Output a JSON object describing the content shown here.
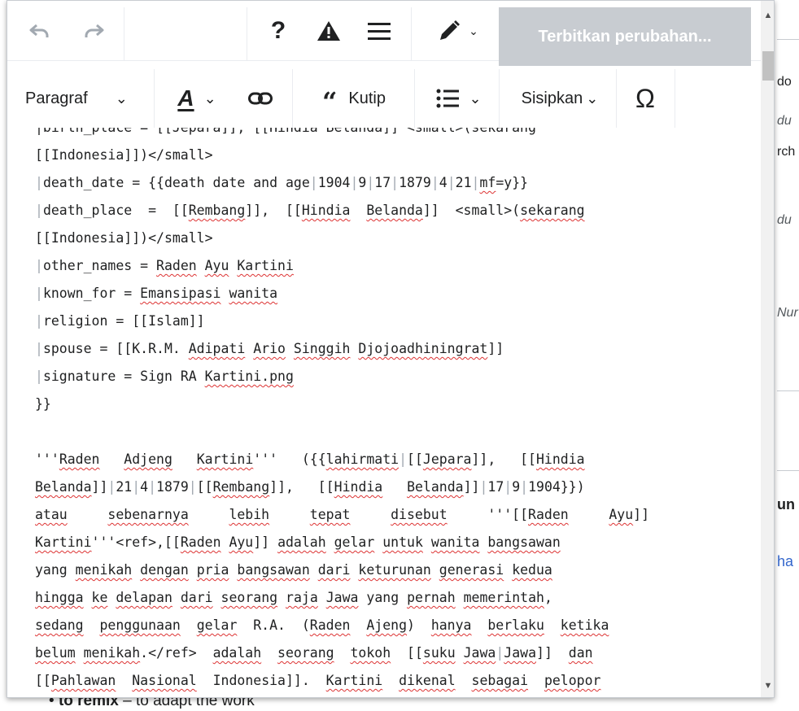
{
  "background": {
    "fragments": [
      "do",
      "du",
      "rch",
      "du",
      "Nur",
      "un",
      "ha"
    ],
    "bottom_bold": "to remix",
    "bottom_rest": " – to adapt the work"
  },
  "toolbar": {
    "undo_icon": "undo-icon",
    "redo_icon": "redo-icon",
    "help_label": "?",
    "notices_label": "▲",
    "page_options_label": "☰",
    "edit_mode_label": "✎",
    "publish_label": "Terbitkan perubahan...",
    "paragraph_label": "Paragraf",
    "style_label": "A",
    "link_icon": "link-icon",
    "quote_label": "Kutip",
    "list_label": "☰",
    "insert_label": "Sisipkan",
    "special_chars_label": "Ω"
  },
  "editor": {
    "lines": [
      [
        {
          "t": "|birth_place = [[Jepara]], [[Hindia Belanda]] <small>(sekarang",
          "s": false
        }
      ],
      [
        {
          "t": "[[Indonesia]])</small>",
          "s": false
        }
      ],
      [
        {
          "t": "|",
          "p": true
        },
        {
          "t": "death_date = {{death date and age",
          "s": false
        },
        {
          "t": "|",
          "p": true
        },
        {
          "t": "1904",
          "s": false
        },
        {
          "t": "|",
          "p": true
        },
        {
          "t": "9",
          "s": false
        },
        {
          "t": "|",
          "p": true
        },
        {
          "t": "17",
          "s": false
        },
        {
          "t": "|",
          "p": true
        },
        {
          "t": "1879",
          "s": false
        },
        {
          "t": "|",
          "p": true
        },
        {
          "t": "4",
          "s": false
        },
        {
          "t": "|",
          "p": true
        },
        {
          "t": "21",
          "s": false
        },
        {
          "t": "|",
          "p": true
        },
        {
          "t": "mf",
          "s": true
        },
        {
          "t": "=y}}",
          "s": false
        }
      ],
      [
        {
          "t": "|",
          "p": true
        },
        {
          "t": "death_place  =  [[",
          "s": false
        },
        {
          "t": "Rembang",
          "s": true
        },
        {
          "t": "]],  [[",
          "s": false
        },
        {
          "t": "Hindia",
          "s": true
        },
        {
          "t": "  ",
          "s": false
        },
        {
          "t": "Belanda",
          "s": true
        },
        {
          "t": "]]  <small>(",
          "s": false
        },
        {
          "t": "sekarang",
          "s": true
        }
      ],
      [
        {
          "t": "[[Indonesia]])</small>",
          "s": false
        }
      ],
      [
        {
          "t": "|",
          "p": true
        },
        {
          "t": "other_names = ",
          "s": false
        },
        {
          "t": "Raden",
          "s": true
        },
        {
          "t": " ",
          "s": false
        },
        {
          "t": "Ayu",
          "s": true
        },
        {
          "t": " ",
          "s": false
        },
        {
          "t": "Kartini",
          "s": true
        }
      ],
      [
        {
          "t": "|",
          "p": true
        },
        {
          "t": "known_for = ",
          "s": false
        },
        {
          "t": "Emansipasi",
          "s": true
        },
        {
          "t": " ",
          "s": false
        },
        {
          "t": "wanita",
          "s": true
        }
      ],
      [
        {
          "t": "|",
          "p": true
        },
        {
          "t": "religion = [[Islam]]",
          "s": false
        }
      ],
      [
        {
          "t": "|",
          "p": true
        },
        {
          "t": "spouse = [[K.R.M. ",
          "s": false
        },
        {
          "t": "Adipati",
          "s": true
        },
        {
          "t": " ",
          "s": false
        },
        {
          "t": "Ario",
          "s": true
        },
        {
          "t": " ",
          "s": false
        },
        {
          "t": "Singgih",
          "s": true
        },
        {
          "t": " ",
          "s": false
        },
        {
          "t": "Djojoadhiningrat",
          "s": true
        },
        {
          "t": "]]",
          "s": false
        }
      ],
      [
        {
          "t": "|",
          "p": true
        },
        {
          "t": "signature = Sign RA ",
          "s": false
        },
        {
          "t": "Kartini.png",
          "s": true
        }
      ],
      [
        {
          "t": "}}",
          "s": false
        }
      ],
      [
        {
          "t": " ",
          "s": false
        }
      ],
      [
        {
          "t": "'''",
          "s": false
        },
        {
          "t": "Raden",
          "s": true
        },
        {
          "t": "   ",
          "s": false
        },
        {
          "t": "Adjeng",
          "s": true
        },
        {
          "t": "   ",
          "s": false
        },
        {
          "t": "Kartini",
          "s": true
        },
        {
          "t": "'''   ({{",
          "s": false
        },
        {
          "t": "lahirmati",
          "s": true
        },
        {
          "t": "|",
          "p": true
        },
        {
          "t": "[[",
          "s": false
        },
        {
          "t": "Jepara",
          "s": true
        },
        {
          "t": "]],   [[",
          "s": false
        },
        {
          "t": "Hindia",
          "s": true
        }
      ],
      [
        {
          "t": "Belanda",
          "s": true
        },
        {
          "t": "]]",
          "s": false
        },
        {
          "t": "|",
          "p": true
        },
        {
          "t": "21",
          "s": false
        },
        {
          "t": "|",
          "p": true
        },
        {
          "t": "4",
          "s": false
        },
        {
          "t": "|",
          "p": true
        },
        {
          "t": "1879",
          "s": false
        },
        {
          "t": "|",
          "p": true
        },
        {
          "t": "[[",
          "s": false
        },
        {
          "t": "Rembang",
          "s": true
        },
        {
          "t": "]],   [[",
          "s": false
        },
        {
          "t": "Hindia",
          "s": true
        },
        {
          "t": "   ",
          "s": false
        },
        {
          "t": "Belanda",
          "s": true
        },
        {
          "t": "]]",
          "s": false
        },
        {
          "t": "|",
          "p": true
        },
        {
          "t": "17",
          "s": false
        },
        {
          "t": "|",
          "p": true
        },
        {
          "t": "9",
          "s": false
        },
        {
          "t": "|",
          "p": true
        },
        {
          "t": "1904}})",
          "s": false
        }
      ],
      [
        {
          "t": "atau",
          "s": true
        },
        {
          "t": "     ",
          "s": false
        },
        {
          "t": "sebenarnya",
          "s": true
        },
        {
          "t": "     ",
          "s": false
        },
        {
          "t": "lebih",
          "s": true
        },
        {
          "t": "     ",
          "s": false
        },
        {
          "t": "tepat",
          "s": true
        },
        {
          "t": "     ",
          "s": false
        },
        {
          "t": "disebut",
          "s": true
        },
        {
          "t": "     '''[[",
          "s": false
        },
        {
          "t": "Raden",
          "s": true
        },
        {
          "t": "     ",
          "s": false
        },
        {
          "t": "Ayu",
          "s": true
        },
        {
          "t": "]]",
          "s": false
        }
      ],
      [
        {
          "t": "Kartini",
          "s": true
        },
        {
          "t": "'''<ref>,[[",
          "s": false
        },
        {
          "t": "Raden",
          "s": true
        },
        {
          "t": " ",
          "s": false
        },
        {
          "t": "Ayu",
          "s": true
        },
        {
          "t": "]] ",
          "s": false
        },
        {
          "t": "adalah",
          "s": true
        },
        {
          "t": " ",
          "s": false
        },
        {
          "t": "gelar",
          "s": true
        },
        {
          "t": " ",
          "s": false
        },
        {
          "t": "untuk",
          "s": true
        },
        {
          "t": " ",
          "s": false
        },
        {
          "t": "wanita",
          "s": true
        },
        {
          "t": " ",
          "s": false
        },
        {
          "t": "bangsawan",
          "s": true
        }
      ],
      [
        {
          "t": "yang ",
          "s": false
        },
        {
          "t": "menikah",
          "s": true
        },
        {
          "t": " ",
          "s": false
        },
        {
          "t": "dengan",
          "s": true
        },
        {
          "t": " ",
          "s": false
        },
        {
          "t": "pria",
          "s": true
        },
        {
          "t": " ",
          "s": false
        },
        {
          "t": "bangsawan",
          "s": true
        },
        {
          "t": " ",
          "s": false
        },
        {
          "t": "dari",
          "s": true
        },
        {
          "t": " ",
          "s": false
        },
        {
          "t": "keturunan",
          "s": true
        },
        {
          "t": " ",
          "s": false
        },
        {
          "t": "generasi",
          "s": true
        },
        {
          "t": " ",
          "s": false
        },
        {
          "t": "kedua",
          "s": true
        }
      ],
      [
        {
          "t": "hingga",
          "s": true
        },
        {
          "t": " ",
          "s": false
        },
        {
          "t": "ke",
          "s": true
        },
        {
          "t": " ",
          "s": false
        },
        {
          "t": "delapan",
          "s": true
        },
        {
          "t": " ",
          "s": false
        },
        {
          "t": "dari",
          "s": true
        },
        {
          "t": " ",
          "s": false
        },
        {
          "t": "seorang",
          "s": true
        },
        {
          "t": " ",
          "s": false
        },
        {
          "t": "raja",
          "s": true
        },
        {
          "t": " ",
          "s": false
        },
        {
          "t": "Jawa",
          "s": true
        },
        {
          "t": " yang ",
          "s": false
        },
        {
          "t": "pernah",
          "s": true
        },
        {
          "t": " ",
          "s": false
        },
        {
          "t": "memerintah",
          "s": true
        },
        {
          "t": ",",
          "s": false
        }
      ],
      [
        {
          "t": "sedang",
          "s": true
        },
        {
          "t": "  ",
          "s": false
        },
        {
          "t": "penggunaan",
          "s": true
        },
        {
          "t": "  ",
          "s": false
        },
        {
          "t": "gelar",
          "s": true
        },
        {
          "t": "  R.A.  (",
          "s": false
        },
        {
          "t": "Raden",
          "s": true
        },
        {
          "t": "  ",
          "s": false
        },
        {
          "t": "Ajeng",
          "s": true
        },
        {
          "t": ")  ",
          "s": false
        },
        {
          "t": "hanya",
          "s": true
        },
        {
          "t": "  ",
          "s": false
        },
        {
          "t": "berlaku",
          "s": true
        },
        {
          "t": "  ",
          "s": false
        },
        {
          "t": "ketika",
          "s": true
        }
      ],
      [
        {
          "t": "belum",
          "s": true
        },
        {
          "t": " ",
          "s": false
        },
        {
          "t": "menikah",
          "s": true
        },
        {
          "t": ".</ref>  ",
          "s": false
        },
        {
          "t": "adalah",
          "s": true
        },
        {
          "t": "  ",
          "s": false
        },
        {
          "t": "seorang",
          "s": true
        },
        {
          "t": "  ",
          "s": false
        },
        {
          "t": "tokoh",
          "s": true
        },
        {
          "t": "  [[",
          "s": false
        },
        {
          "t": "suku",
          "s": true
        },
        {
          "t": " ",
          "s": false
        },
        {
          "t": "Jawa",
          "s": true
        },
        {
          "t": "|",
          "p": true
        },
        {
          "t": "Jawa",
          "s": true
        },
        {
          "t": "]]  ",
          "s": false
        },
        {
          "t": "dan",
          "s": true
        }
      ],
      [
        {
          "t": "[[",
          "s": false
        },
        {
          "t": "Pahlawan",
          "s": true
        },
        {
          "t": "  ",
          "s": false
        },
        {
          "t": "Nasional",
          "s": true
        },
        {
          "t": "  Indonesia]].  ",
          "s": false
        },
        {
          "t": "Kartini",
          "s": true
        },
        {
          "t": "  ",
          "s": false
        },
        {
          "t": "dikenal",
          "s": true
        },
        {
          "t": "  ",
          "s": false
        },
        {
          "t": "sebagai",
          "s": true
        },
        {
          "t": "  ",
          "s": false
        },
        {
          "t": "pelopor",
          "s": true
        }
      ]
    ]
  }
}
